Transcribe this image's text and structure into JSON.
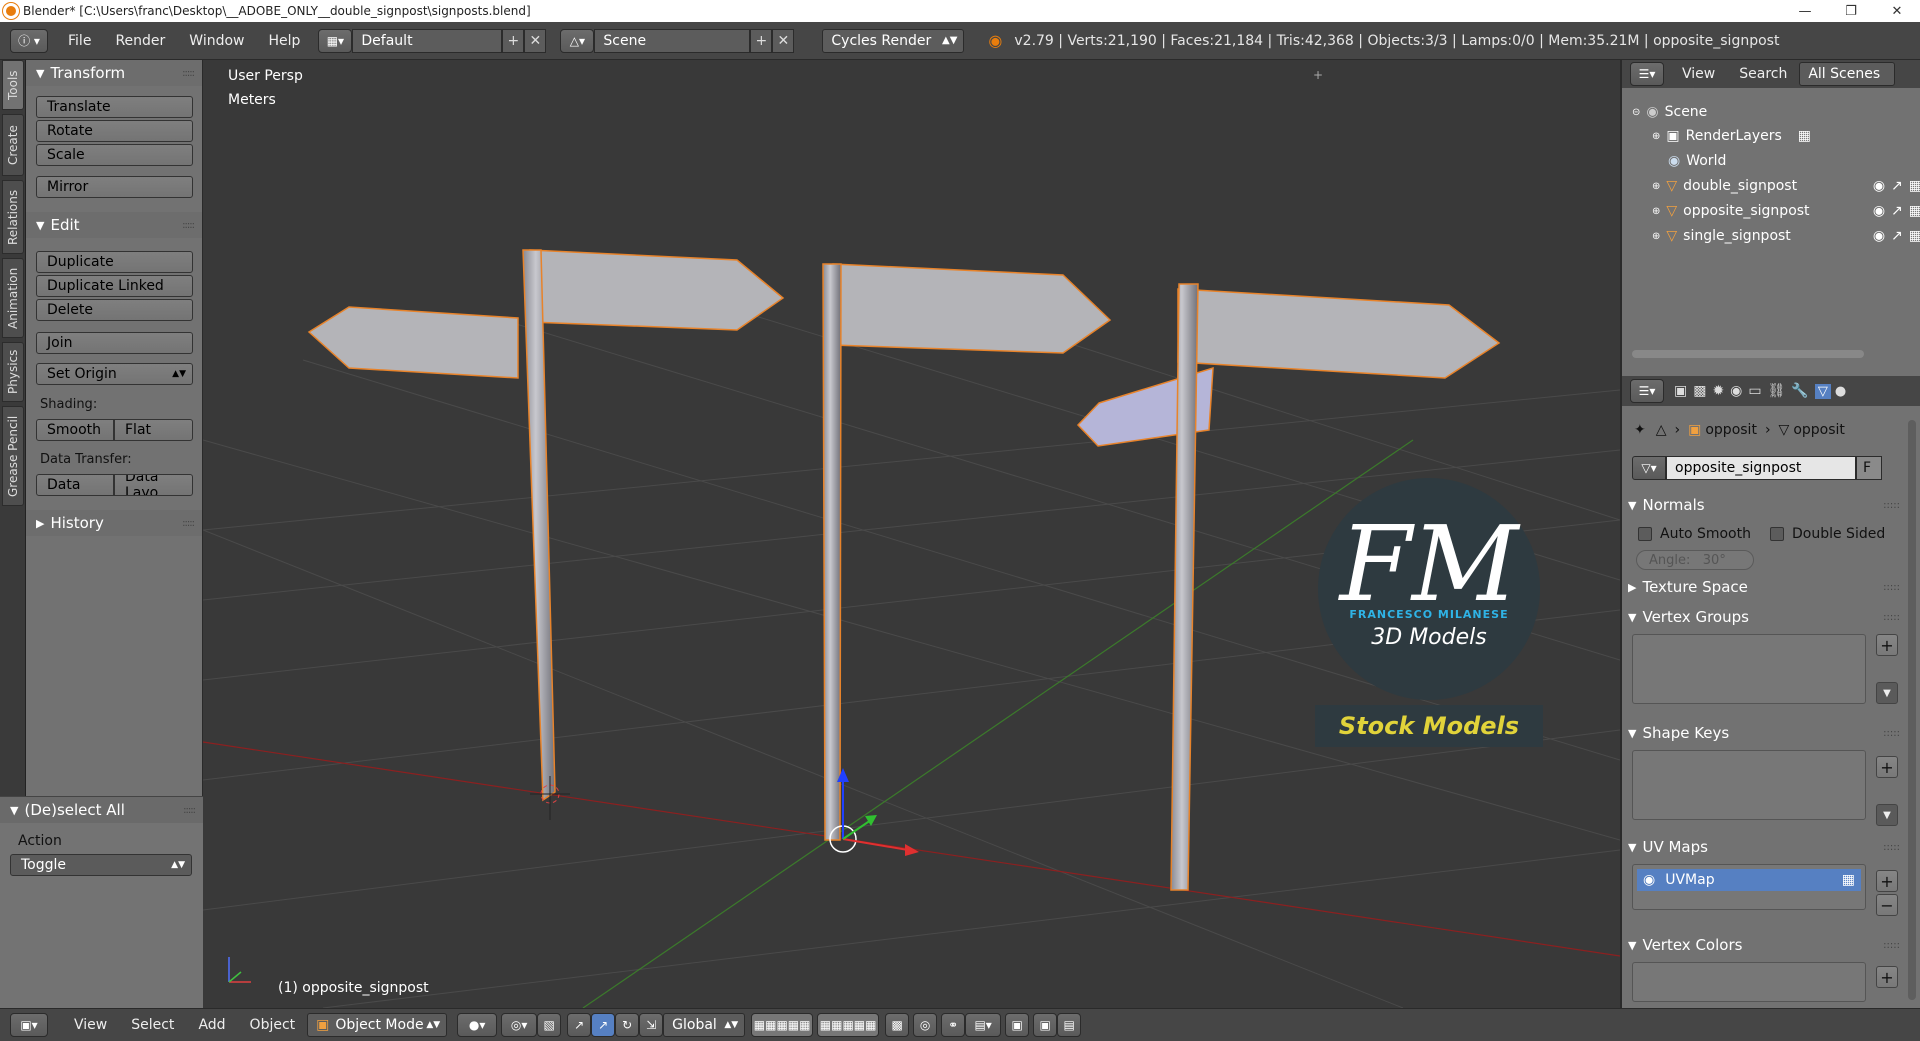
{
  "window": {
    "title": "Blender* [C:\\Users\\franc\\Desktop\\__ADOBE_ONLY__double_signpost\\signposts.blend]"
  },
  "info": {
    "menus": [
      "File",
      "Render",
      "Window",
      "Help"
    ],
    "screen_layout": "Default",
    "scene": "Scene",
    "engine": "Cycles Render",
    "stats": "v2.79 | Verts:21,190 | Faces:21,184 | Tris:42,368 | Objects:3/3 | Lamps:0/0 | Mem:35.21M | opposite_signpost"
  },
  "toolshelf": {
    "tabs": [
      "Tools",
      "Create",
      "Relations",
      "Animation",
      "Physics",
      "Grease Pencil"
    ],
    "transform": {
      "title": "Transform",
      "buttons": [
        "Translate",
        "Rotate",
        "Scale",
        "Mirror"
      ]
    },
    "edit": {
      "title": "Edit",
      "buttons": [
        "Duplicate",
        "Duplicate Linked",
        "Delete",
        "Join"
      ],
      "set_origin": "Set Origin",
      "shading_label": "Shading:",
      "smooth": "Smooth",
      "flat": "Flat",
      "data_transfer_label": "Data Transfer:",
      "data": "Data",
      "data_layo": "Data Layo"
    },
    "history": {
      "title": "History"
    },
    "operator": {
      "title": "(De)select All",
      "action_label": "Action",
      "action_value": "Toggle"
    }
  },
  "viewport": {
    "view_name": "User Persp",
    "units": "Meters",
    "active_object": "(1) opposite_signpost",
    "watermark": {
      "line1": "FM",
      "line2": "FRANCESCO MILANESE",
      "line3": "3D Models",
      "line4": "Stock Models"
    }
  },
  "outliner": {
    "menus": [
      "View",
      "Search"
    ],
    "filter": "All Scenes",
    "items": [
      {
        "label": "Scene"
      },
      {
        "label": "RenderLayers"
      },
      {
        "label": "World"
      },
      {
        "label": "double_signpost"
      },
      {
        "label": "opposite_signpost"
      },
      {
        "label": "single_signpost"
      }
    ]
  },
  "properties": {
    "breadcrumb": [
      "opposit",
      "opposit"
    ],
    "data_name": "opposite_signpost",
    "fake_user": "F",
    "normals": {
      "title": "Normals",
      "auto_smooth": "Auto Smooth",
      "double_sided": "Double Sided",
      "angle": "Angle:   30°"
    },
    "texture_space": {
      "title": "Texture Space"
    },
    "vertex_groups": {
      "title": "Vertex Groups"
    },
    "shape_keys": {
      "title": "Shape Keys"
    },
    "uv_maps": {
      "title": "UV Maps",
      "item": "UVMap"
    },
    "vertex_colors": {
      "title": "Vertex Colors"
    }
  },
  "bottombar": {
    "menus": [
      "View",
      "Select",
      "Add",
      "Object"
    ],
    "mode": "Object Mode",
    "orientation": "Global"
  }
}
